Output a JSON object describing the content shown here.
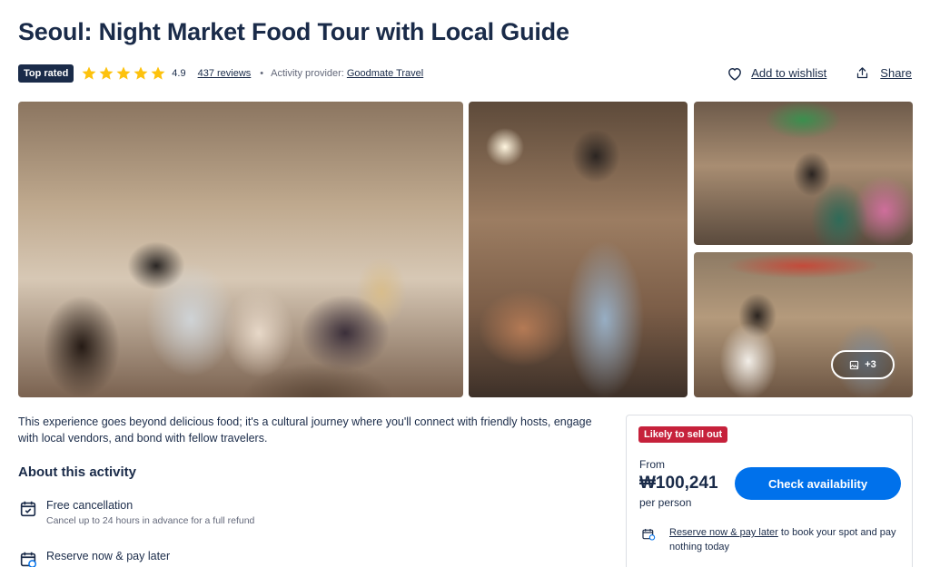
{
  "page": {
    "title": "Seoul: Night Market Food Tour with Local Guide"
  },
  "meta": {
    "badge": "Top rated",
    "rating": "4.9",
    "stars": 5,
    "reviews": "437 reviews",
    "separator": "•",
    "provider_label": "Activity provider:",
    "provider_name": "Goodmate Travel",
    "wishlist_label": "Add to wishlist",
    "share_label": "Share"
  },
  "gallery": {
    "more_count": "+3"
  },
  "description": "This experience goes beyond delicious food; it's a cultural journey where you'll connect with friendly hosts, engage with local vendors, and bond with fellow travelers.",
  "about": {
    "title": "About this activity",
    "features": [
      {
        "title": "Free cancellation",
        "subtitle": "Cancel up to 24 hours in advance for a full refund",
        "icon": "calendar-check-icon"
      },
      {
        "title": "Reserve now & pay later",
        "icon": "calendar-card-icon"
      }
    ]
  },
  "booking": {
    "badge": "Likely to sell out",
    "from_label": "From",
    "price": "₩100,241",
    "per_label": "per person",
    "button_label": "Check availability",
    "reserve_link": "Reserve now & pay later",
    "reserve_text": " to book your spot and pay nothing today"
  },
  "colors": {
    "brand_navy": "#1a2b49",
    "primary_blue": "#0071eb",
    "sell_out_red": "#c6213b",
    "star_yellow": "#fdc20d"
  }
}
